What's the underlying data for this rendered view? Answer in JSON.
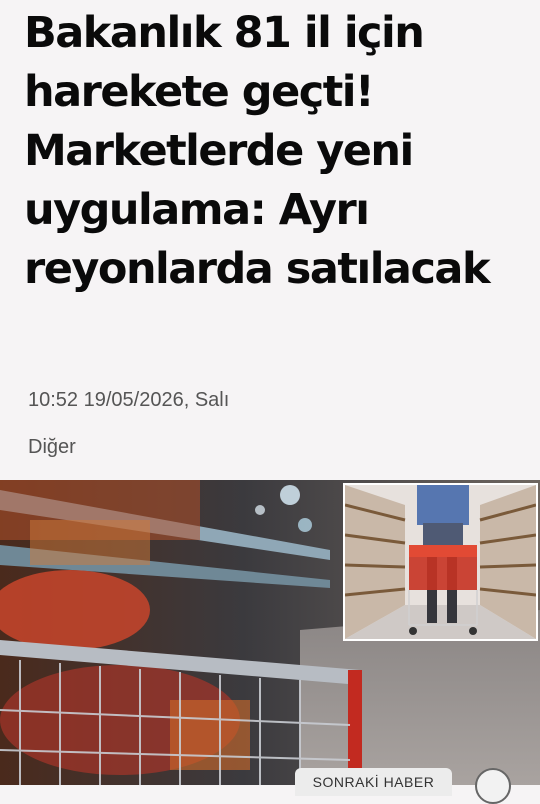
{
  "article": {
    "title": "Bakanlık 81 il için harekete geçti! Marketlerde yeni uygulama: Ayrı reyonlarda satılacak",
    "datetime": "10:52 19/05/2026, Salı",
    "category": "Diğer"
  },
  "hero": {
    "alt": "supermarket-shopping-cart"
  },
  "nav": {
    "next_label": "SONRAKİ HABER",
    "scroll_icon": "circle-arrow-icon"
  }
}
